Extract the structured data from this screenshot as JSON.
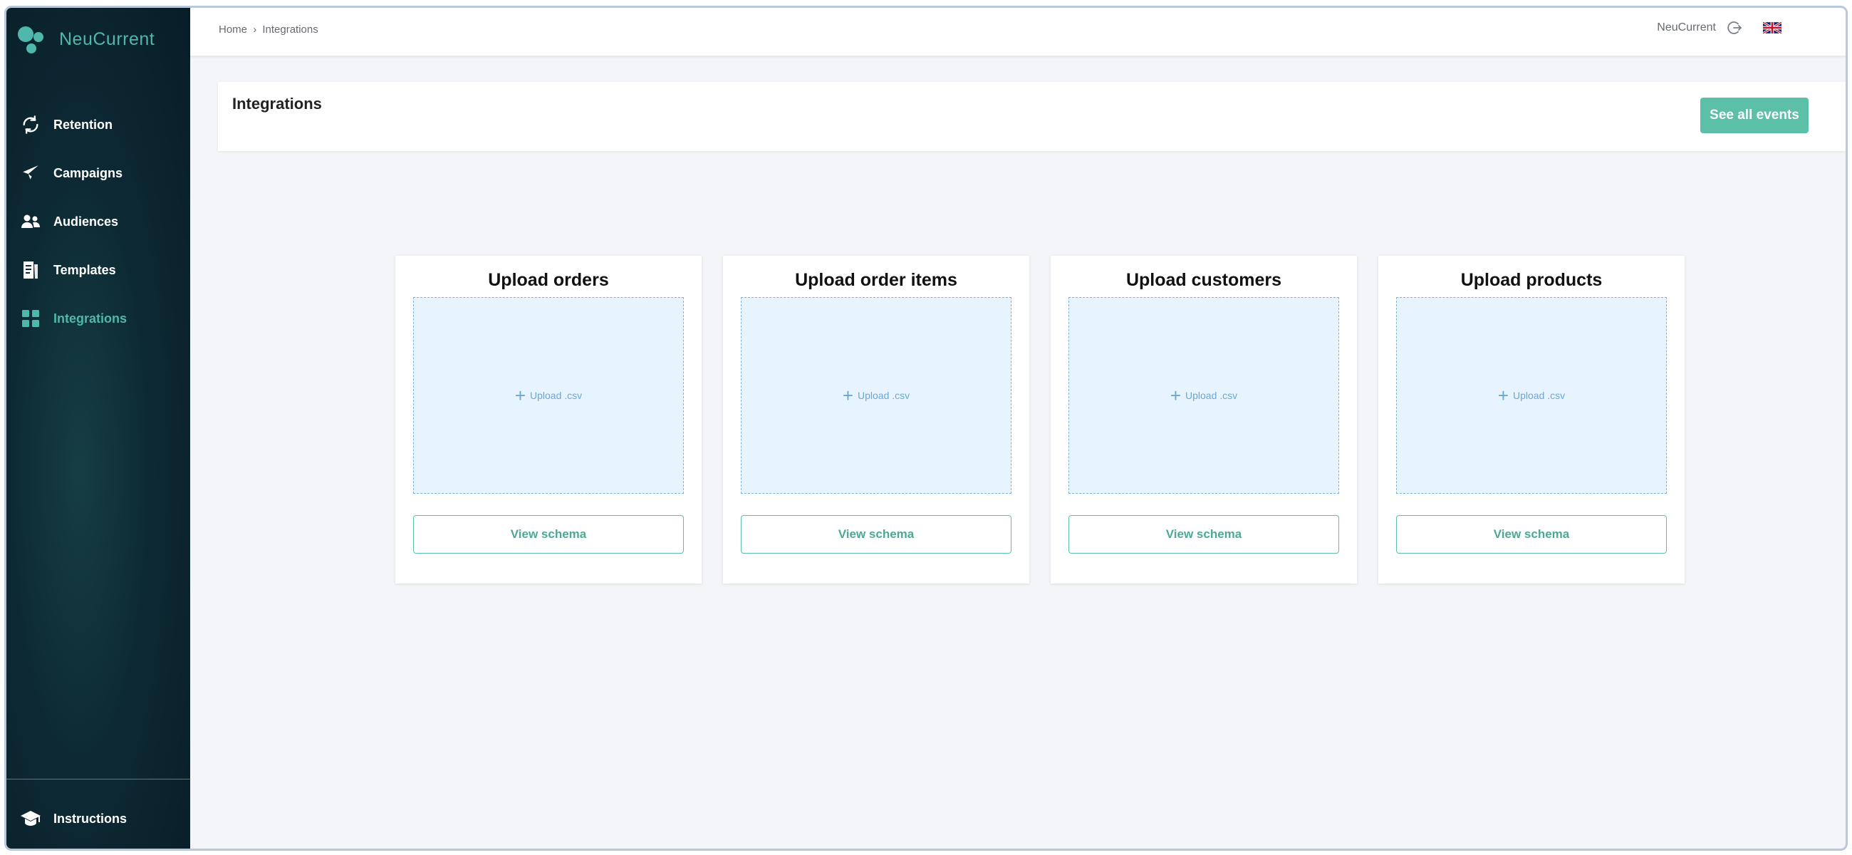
{
  "app": {
    "name": "NeuCurrent"
  },
  "colors": {
    "accent": "#5cbfa8",
    "sidebar_bg": "#0d2a34",
    "dropzone_bg": "#e8f4fd"
  },
  "sidebar": {
    "items": [
      {
        "label": "Retention",
        "icon": "refresh-icon",
        "active": false
      },
      {
        "label": "Campaigns",
        "icon": "paper-plane-icon",
        "active": false
      },
      {
        "label": "Audiences",
        "icon": "users-icon",
        "active": false
      },
      {
        "label": "Templates",
        "icon": "document-icon",
        "active": false
      },
      {
        "label": "Integrations",
        "icon": "grid-icon",
        "active": true
      }
    ],
    "bottom": {
      "label": "Instructions",
      "icon": "graduation-cap-icon"
    }
  },
  "topbar": {
    "breadcrumb": [
      "Home",
      "Integrations"
    ],
    "breadcrumb_separator": "›",
    "user": "NeuCurrent",
    "language": "English (UK flag)"
  },
  "header": {
    "title": "Integrations",
    "button_label": "See all events"
  },
  "cards": [
    {
      "title": "Upload orders",
      "upload_label": "Upload .csv",
      "button_label": "View schema"
    },
    {
      "title": "Upload order items",
      "upload_label": "Upload .csv",
      "button_label": "View schema"
    },
    {
      "title": "Upload customers",
      "upload_label": "Upload .csv",
      "button_label": "View schema"
    },
    {
      "title": "Upload products",
      "upload_label": "Upload .csv",
      "button_label": "View schema"
    }
  ]
}
